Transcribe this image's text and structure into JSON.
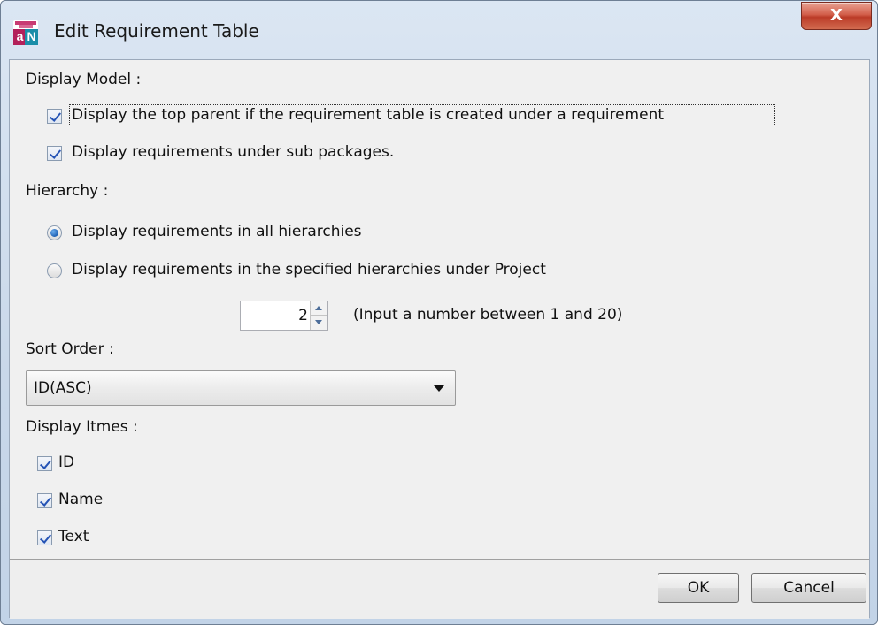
{
  "window": {
    "title": "Edit Requirement Table",
    "close_label": "X"
  },
  "display_model": {
    "heading": "Display Model :",
    "options": [
      {
        "label": "Display the top parent if the requirement table is created under a requirement",
        "checked": true
      },
      {
        "label": "Display requirements under sub packages.",
        "checked": true
      }
    ]
  },
  "hierarchy": {
    "heading": "Hierarchy :",
    "options": [
      {
        "label": "Display requirements in all hierarchies",
        "selected": true
      },
      {
        "label": "Display requirements in the specified hierarchies under Project",
        "selected": false
      }
    ],
    "level_value": "2",
    "level_hint": "(Input a number between 1 and 20)"
  },
  "sort_order": {
    "heading": "Sort Order :",
    "selected": "ID(ASC)"
  },
  "display_items": {
    "heading": "Display Itmes :",
    "items": [
      {
        "label": "ID",
        "checked": true
      },
      {
        "label": "Name",
        "checked": true
      },
      {
        "label": "Text",
        "checked": true
      }
    ]
  },
  "footer": {
    "ok_label": "OK",
    "cancel_label": "Cancel"
  }
}
